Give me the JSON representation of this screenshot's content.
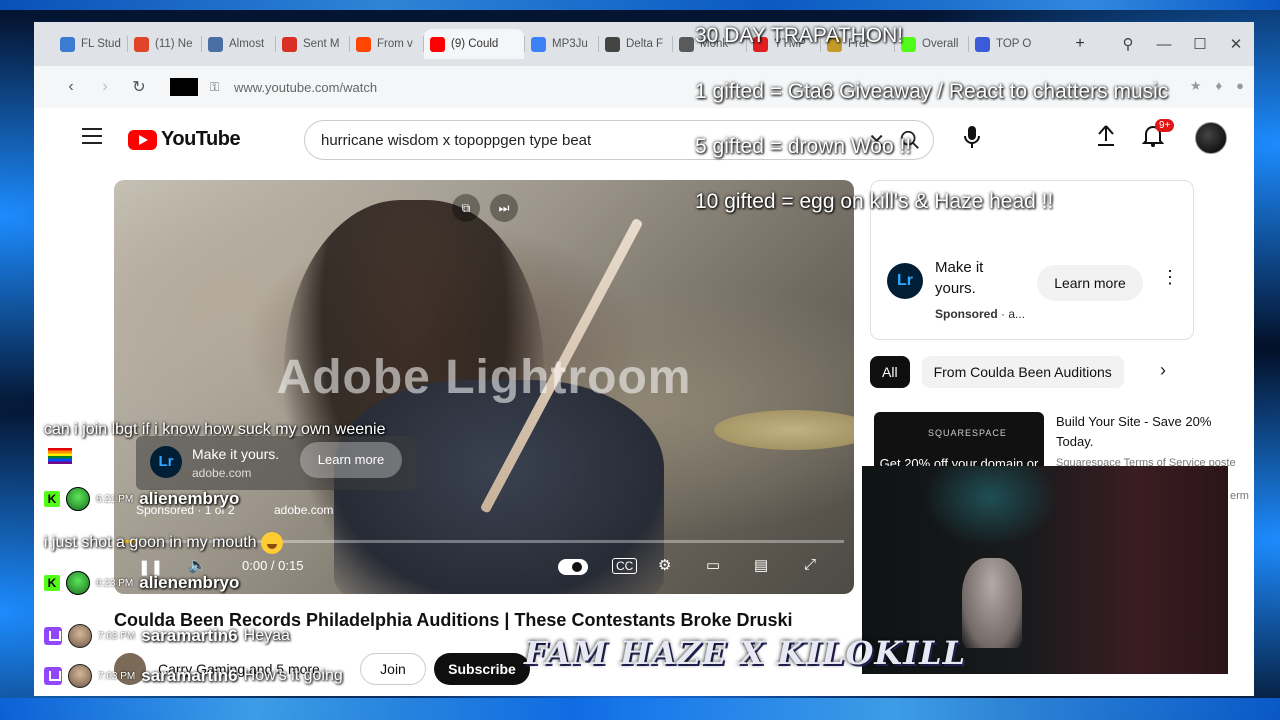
{
  "tabs": [
    {
      "label": "FL Stud",
      "color": "#3d7ad1"
    },
    {
      "label": "(11) Ne",
      "color": "#e0452a"
    },
    {
      "label": "Almost",
      "color": "#4a6fa5"
    },
    {
      "label": "Sent M",
      "color": "#d93025"
    },
    {
      "label": "From v",
      "color": "#ff4500"
    },
    {
      "label": "(9) Could",
      "color": "#ff0000",
      "active": true
    },
    {
      "label": "MP3Ju",
      "color": "#3b82f6"
    },
    {
      "label": "Delta F",
      "color": "#444444"
    },
    {
      "label": "Monk",
      "color": "#5a5a5a"
    },
    {
      "label": "YTMP",
      "color": "#e02020"
    },
    {
      "label": "Fret",
      "color": "#c39b2b"
    },
    {
      "label": "Overall",
      "color": "#53fc18"
    },
    {
      "label": "TOP O",
      "color": "#3b5bdb"
    }
  ],
  "address": {
    "url": "www.youtube.com/watch"
  },
  "youtube": {
    "logo": "YouTube",
    "search_value": "hurricane wisdom x topoppgen type beat",
    "notifications": "9+",
    "player": {
      "watermark": "Adobe Lightroom",
      "ad_title": "Make it yours.",
      "ad_domain": "adobe.com",
      "ad_learn": "Learn more",
      "sponsored": "Sponsored · 1 of 2",
      "sponsored_domain": "adobe.com",
      "time": "0:00 / 0:15",
      "progress": 0.02
    },
    "video_title": "Coulda Been Records Philadelphia Auditions | These Contestants Broke Druski",
    "channel": "Carry Gaming and 5 more",
    "join": "Join",
    "subscribe": "Subscribe",
    "side_ad": {
      "title": "Make it yours.",
      "sponsored": "Sponsored",
      "sponsored_suffix": " · a...",
      "learn": "Learn more"
    },
    "chips": [
      "All",
      "From Coulda Been Auditions"
    ],
    "rec": {
      "brand": "SQUARESPACE",
      "thumb_text": "Get 20% off your domain or",
      "title": "Build Your Site - Save 20% Today.",
      "meta": "Squarespace Terms of Service poste at",
      "meta_tail": "erm"
    }
  },
  "overlay": {
    "line1": "30 DAY TRAPATHON!",
    "line2": "1 gifted = Gta6 Giveaway / React to chatters music",
    "line3": "5 gifted = drown Woo  !!",
    "line4": "10 gifted = egg on kill's & Haze head  !!"
  },
  "chat": [
    {
      "text": "can i join lbgt if i know how suck my own weenie"
    },
    {
      "time": "6:21 PM",
      "user": "alienembryo",
      "platform": "kick"
    },
    {
      "text": "i just shot a goon in my mouth"
    },
    {
      "time": "6:23 PM",
      "user": "alienembryo",
      "platform": "kick"
    },
    {
      "time": "7:03 PM",
      "user": "saramartin6",
      "text": "Heyaa",
      "platform": "twitch"
    },
    {
      "time": "7:03 PM",
      "user": "saramartin6",
      "text": "How's it going",
      "platform": "twitch"
    }
  ],
  "brand_logo": "FAM HAZE X KILOKILL"
}
